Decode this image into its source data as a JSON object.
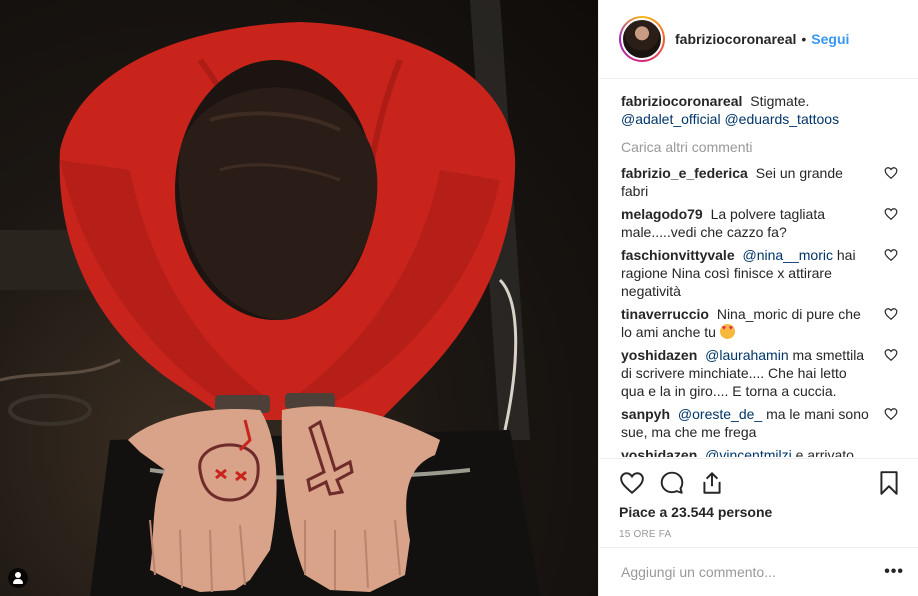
{
  "post": {
    "username": "fabriziocoronareal",
    "separator": "•",
    "follow_label": "Segui",
    "caption_text": "Stigmate.",
    "caption_mentions": [
      "@adalet_official",
      "@eduards_tattoos"
    ],
    "load_more_label": "Carica altri commenti",
    "comments": [
      {
        "user": "fabrizio_e_federica",
        "text": "Sei un grande fabri"
      },
      {
        "user": "melagodo79",
        "text": "La polvere tagliata male.....vedi che cazzo fa?"
      },
      {
        "user": "faschionvittyvale",
        "mention": "@nina__moric",
        "text": "hai ragione Nina così finisce x attirare negatività"
      },
      {
        "user": "tinaverruccio",
        "text": "Nina_moric di pure che lo ami anche tu"
      },
      {
        "user": "yoshidazen",
        "mention": "@laurahamin",
        "text": "ma smettila di scrivere minchiate.... Che hai letto qua e la in giro.... E torna a cuccia."
      },
      {
        "user": "sanpyh",
        "mention": "@oreste_de_",
        "text": "ma le mani sono sue, ma che me frega"
      },
      {
        "user": "yoshidazen",
        "mention": "@vincentmilzi",
        "text": "e arrivato Vincent ma che cazzo vuoi spiegare"
      }
    ],
    "likes_label": "Piace a 23.544 persone",
    "timestamp": "15 ORE FA",
    "add_comment_placeholder": "Aggiungi un commento...",
    "more_options": "•••"
  },
  "icons": {
    "like": "heart-icon",
    "comment": "speech-bubble-icon",
    "share": "share-icon",
    "save": "bookmark-icon",
    "user_tag": "user-tag-icon"
  },
  "colors": {
    "accent": "#3897f0",
    "mention": "#003569",
    "muted": "#999999",
    "shirt": "#c8241c"
  }
}
